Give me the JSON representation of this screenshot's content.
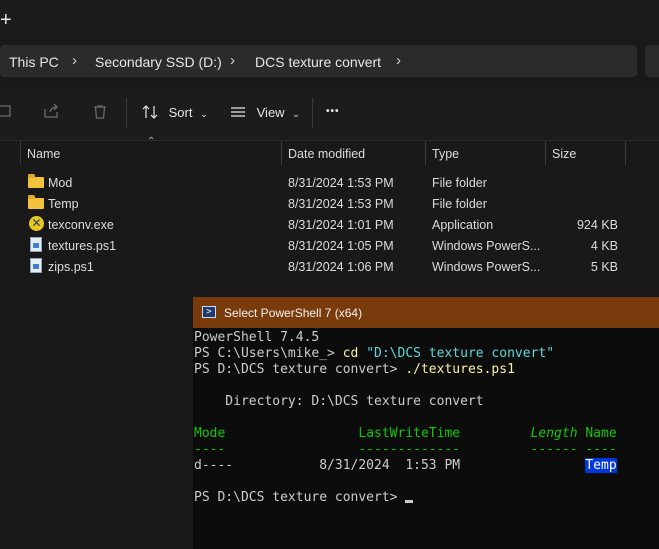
{
  "topbar": {
    "new_tab_glyph": "+"
  },
  "breadcrumb": {
    "items": [
      "This PC",
      "Secondary SSD (D:)",
      "DCS texture convert"
    ],
    "separator": "›"
  },
  "toolbar": {
    "sort_label": "Sort",
    "view_label": "View",
    "more_label": "•••"
  },
  "file_list": {
    "columns": [
      "Name",
      "Date modified",
      "Type",
      "Size"
    ],
    "rows": [
      {
        "icon": "folder-icon",
        "name": "Mod",
        "date": "8/31/2024 1:53 PM",
        "type": "File folder",
        "size": ""
      },
      {
        "icon": "folder-icon",
        "name": "Temp",
        "date": "8/31/2024 1:53 PM",
        "type": "File folder",
        "size": ""
      },
      {
        "icon": "app-icon",
        "name": "texconv.exe",
        "date": "8/31/2024 1:01 PM",
        "type": "Application",
        "size": "924 KB"
      },
      {
        "icon": "script-icon",
        "name": "textures.ps1",
        "date": "8/31/2024 1:05 PM",
        "type": "Windows PowerS...",
        "size": "4 KB"
      },
      {
        "icon": "script-icon",
        "name": "zips.ps1",
        "date": "8/31/2024 1:06 PM",
        "type": "Windows PowerS...",
        "size": "5 KB"
      }
    ]
  },
  "powershell": {
    "title": "Select PowerShell 7 (x64)",
    "version_line": "PowerShell 7.4.5",
    "line2_prompt": "PS C:\\Users\\mike_> ",
    "line2_cmd": "cd",
    "line2_arg": " \"D:\\DCS texture convert\"",
    "line3_prompt": "PS D:\\DCS texture convert> ",
    "line3_cmd": "./textures.ps1",
    "directory_line": "    Directory: D:\\DCS texture convert",
    "header_mode": "Mode",
    "header_lwt": "                 LastWriteTime",
    "header_length": "         Length",
    "header_name": " Name",
    "dash_line": "----                 -------------         ------ ----",
    "row_mode_date": "d----           8/31/2024  1:53 PM                ",
    "row_name": "Temp",
    "final_prompt": "PS D:\\DCS texture convert> "
  },
  "colors": {
    "title_bar": "#7a3b0c",
    "console_bg": "#0c0c0c",
    "selection": "#0037da",
    "header_green": "#16c60c",
    "command_yellow": "#f9f1a5",
    "string_cyan": "#61d6d6"
  }
}
